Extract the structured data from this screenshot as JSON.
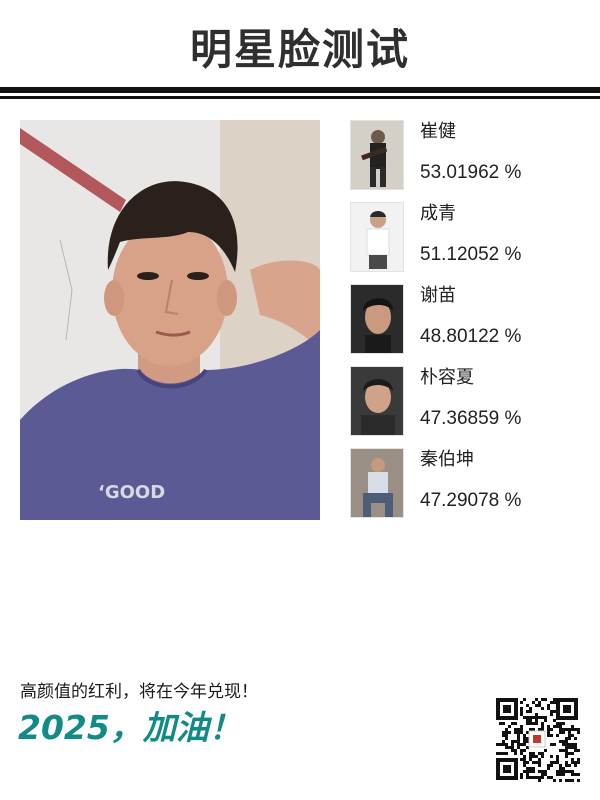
{
  "header": {
    "title": "明星脸测试"
  },
  "main_photo": {
    "icon": "user-portrait-photo"
  },
  "matches": [
    {
      "name": "崔健",
      "score": "53.01962 %",
      "icon": "celebrity-thumbnail"
    },
    {
      "name": "成青",
      "score": "51.12052 %",
      "icon": "celebrity-thumbnail"
    },
    {
      "name": "谢苗",
      "score": "48.80122 %",
      "icon": "celebrity-thumbnail"
    },
    {
      "name": "朴容夏",
      "score": "47.36859 %",
      "icon": "celebrity-thumbnail"
    },
    {
      "name": "秦伯坤",
      "score": "47.29078 %",
      "icon": "celebrity-thumbnail"
    }
  ],
  "footer": {
    "slogan": "高颜值的红利，将在今年兑现！",
    "cheer": "2025，加油！",
    "qr_icon": "qr-code-icon"
  },
  "colors": {
    "title": "#2f2f2f",
    "rule": "#111111",
    "cheer": "#128a86",
    "text": "#222222"
  }
}
